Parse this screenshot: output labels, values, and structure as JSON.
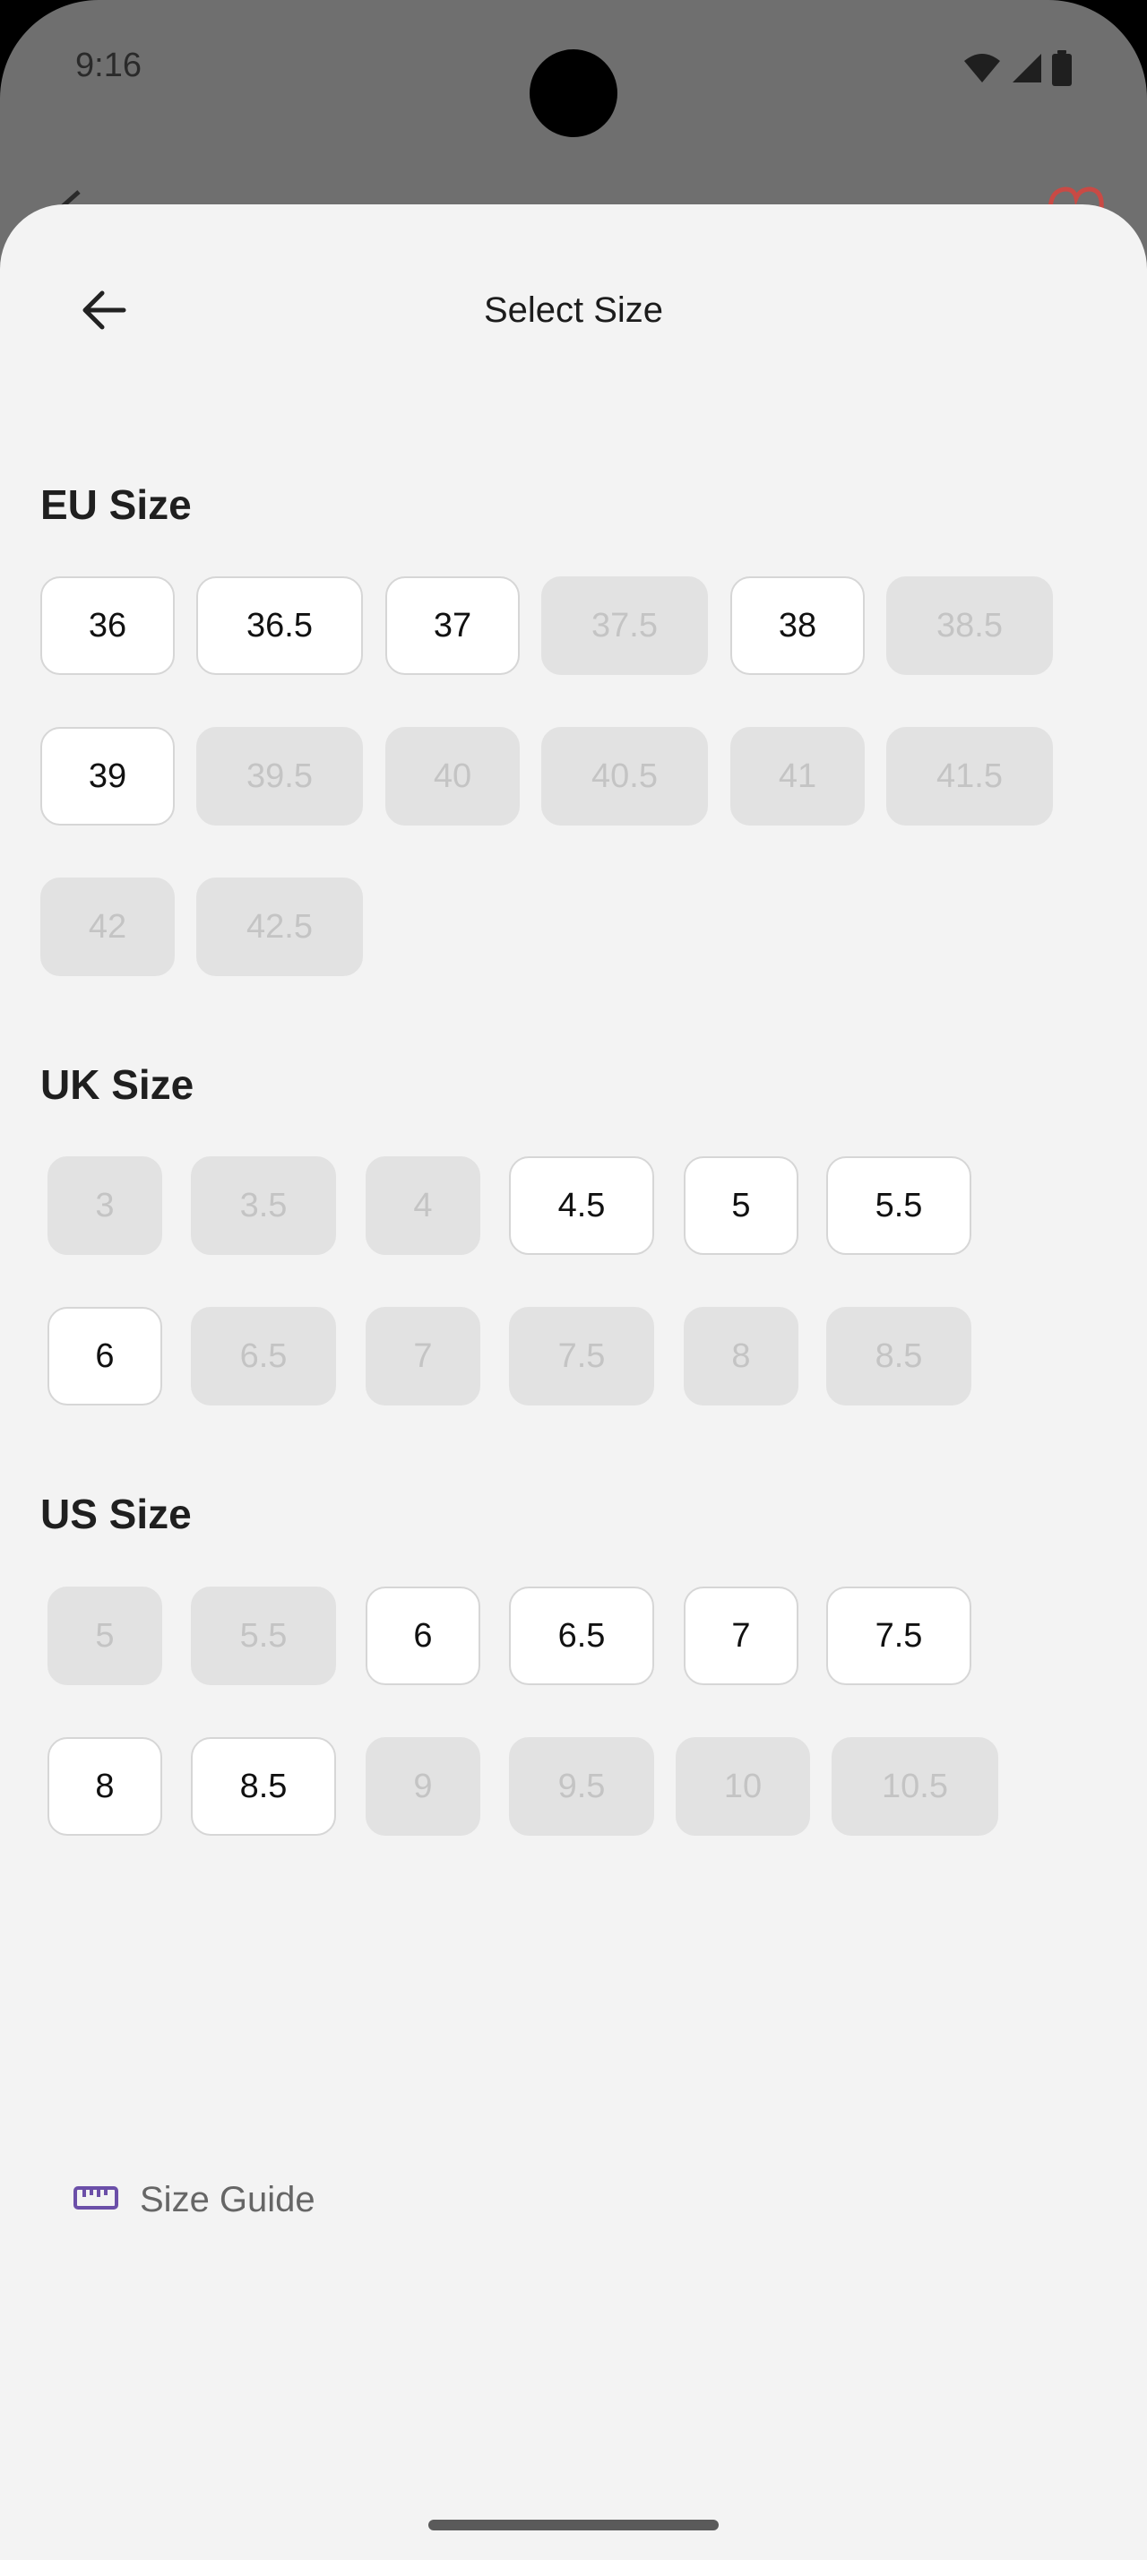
{
  "status_bar": {
    "time": "9:16",
    "icons": [
      "wifi-icon",
      "signal-icon",
      "battery-icon"
    ]
  },
  "header": {
    "title": "Select Size",
    "back_icon": "arrow-left-icon"
  },
  "sections": {
    "eu": {
      "title": "EU Size",
      "sizes": [
        {
          "label": "36",
          "available": true
        },
        {
          "label": "36.5",
          "available": true
        },
        {
          "label": "37",
          "available": true
        },
        {
          "label": "37.5",
          "available": false
        },
        {
          "label": "38",
          "available": true
        },
        {
          "label": "38.5",
          "available": false
        },
        {
          "label": "39",
          "available": true
        },
        {
          "label": "39.5",
          "available": false
        },
        {
          "label": "40",
          "available": false
        },
        {
          "label": "40.5",
          "available": false
        },
        {
          "label": "41",
          "available": false
        },
        {
          "label": "41.5",
          "available": false
        },
        {
          "label": "42",
          "available": false
        },
        {
          "label": "42.5",
          "available": false
        }
      ]
    },
    "uk": {
      "title": "UK Size",
      "sizes": [
        {
          "label": "3",
          "available": false
        },
        {
          "label": "3.5",
          "available": false
        },
        {
          "label": "4",
          "available": false
        },
        {
          "label": "4.5",
          "available": true
        },
        {
          "label": "5",
          "available": true
        },
        {
          "label": "5.5",
          "available": true
        },
        {
          "label": "6",
          "available": true
        },
        {
          "label": "6.5",
          "available": false
        },
        {
          "label": "7",
          "available": false
        },
        {
          "label": "7.5",
          "available": false
        },
        {
          "label": "8",
          "available": false
        },
        {
          "label": "8.5",
          "available": false
        }
      ]
    },
    "us": {
      "title": "US Size",
      "sizes": [
        {
          "label": "5",
          "available": false
        },
        {
          "label": "5.5",
          "available": false
        },
        {
          "label": "6",
          "available": true
        },
        {
          "label": "6.5",
          "available": true
        },
        {
          "label": "7",
          "available": true
        },
        {
          "label": "7.5",
          "available": true
        },
        {
          "label": "8",
          "available": true
        },
        {
          "label": "8.5",
          "available": true
        },
        {
          "label": "9",
          "available": false
        },
        {
          "label": "9.5",
          "available": false
        },
        {
          "label": "10",
          "available": false
        },
        {
          "label": "10.5",
          "available": false
        }
      ]
    }
  },
  "size_guide": {
    "label": "Size Guide",
    "icon": "ruler-icon"
  },
  "colors": {
    "accent": "#6b4fa8",
    "sheet_bg": "#f3f3f3",
    "chip_unavailable": "#e2e2e2",
    "favorite": "#d9534f"
  }
}
